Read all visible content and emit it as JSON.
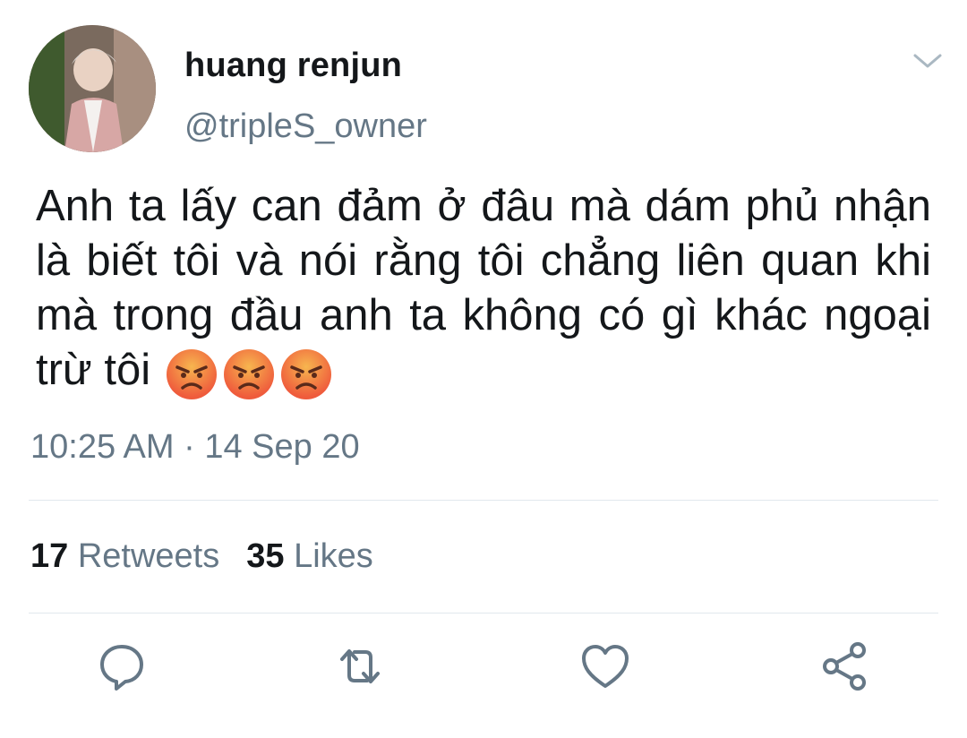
{
  "user": {
    "display_name": "huang renjun",
    "handle": "@tripleS_owner"
  },
  "tweet": {
    "text": "Anh ta lấy can đảm ở đâu mà dám phủ nhận là biết tôi và nói rằng tôi chẳng liên quan khi mà trong đầu anh ta không có gì khác ngoại trừ tôi",
    "emojis": [
      "angry-face-icon",
      "angry-face-icon",
      "angry-face-icon"
    ],
    "time": "10:25 AM",
    "separator": " · ",
    "date": "14 Sep 20"
  },
  "stats": {
    "retweets_count": "17",
    "retweets_label": " Retweets",
    "likes_count": "35",
    "likes_label": " Likes"
  },
  "actions": [
    "reply-icon",
    "retweet-icon",
    "like-icon",
    "share-icon"
  ],
  "colors": {
    "text_primary": "#14171a",
    "text_secondary": "#657786",
    "divider": "#e1e8ed",
    "icon": "#657786",
    "emoji_fill": "#f4a04a",
    "emoji_red": "#f0573d"
  }
}
